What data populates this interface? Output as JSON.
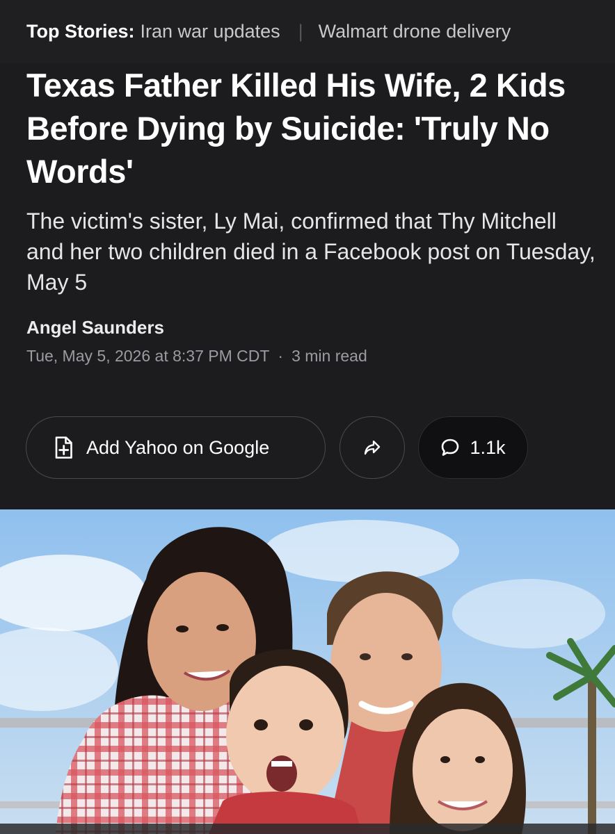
{
  "top_bar": {
    "label": "Top Stories:",
    "stories": [
      "Iran war updates",
      "Walmart drone delivery"
    ]
  },
  "article": {
    "headline": "Texas Father Killed His Wife, 2 Kids Before Dying by Suicide: 'Truly No Words'",
    "subhead": "The victim's sister, Ly Mai, confirmed that Thy Mitchell and her two children died in a Facebook post on Tuesday, May 5",
    "author": "Angel Saunders",
    "date": "Tue, May 5, 2026 at 8:37 PM CDT",
    "read_time": "3 min read"
  },
  "actions": {
    "add_label": "Add Yahoo on Google",
    "add_icon": "add-document-icon",
    "share_icon": "share-arrow-icon",
    "comment_icon": "comment-bubble-icon",
    "comment_count": "1.1k"
  },
  "colors": {
    "background": "#1c1b1e",
    "top_bar": "#1f1f21",
    "meta_text": "#9b9ba1",
    "sky": "#a9cdef"
  }
}
